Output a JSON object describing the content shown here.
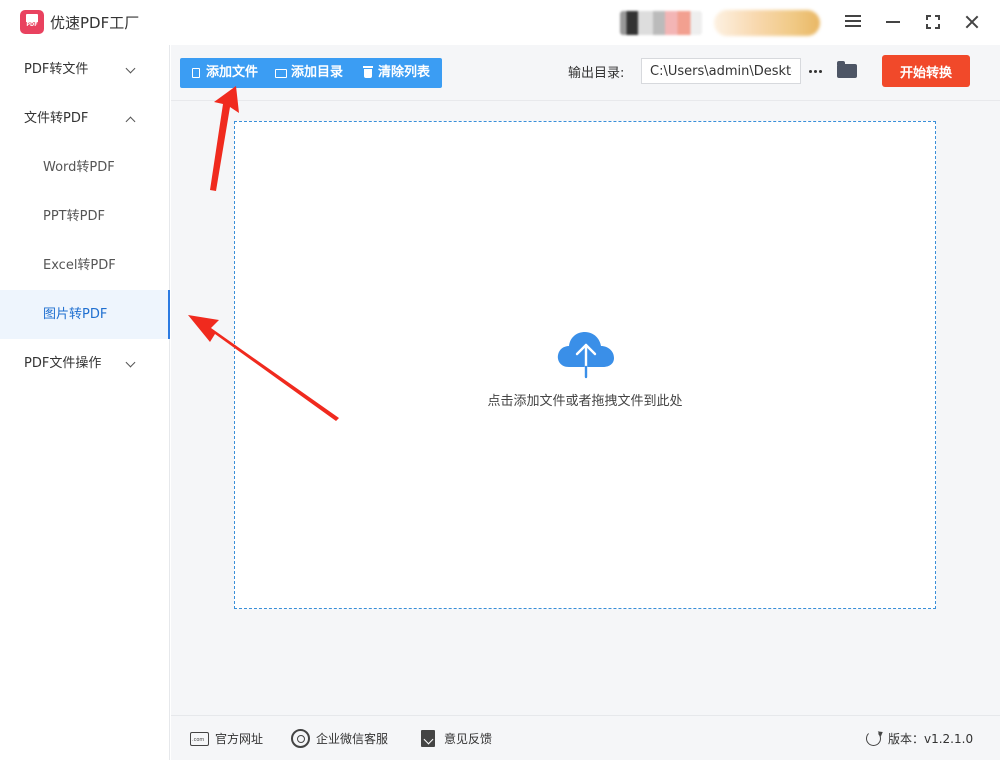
{
  "app": {
    "title": "优速PDF工厂",
    "logo_icon": "pdf-logo-icon"
  },
  "window_controls": [
    "menu-icon",
    "minimize-icon",
    "maximize-icon",
    "close-icon"
  ],
  "sidebar": {
    "groups": [
      {
        "label": "PDF转文件",
        "expanded": false
      },
      {
        "label": "文件转PDF",
        "expanded": true,
        "items": [
          {
            "label": "Word转PDF",
            "active": false
          },
          {
            "label": "PPT转PDF",
            "active": false
          },
          {
            "label": "Excel转PDF",
            "active": false
          },
          {
            "label": "图片转PDF",
            "active": true
          }
        ]
      },
      {
        "label": "PDF文件操作",
        "expanded": false
      }
    ]
  },
  "toolbar": {
    "add_file": "添加文件",
    "add_dir": "添加目录",
    "clear_list": "清除列表",
    "output_label": "输出目录:",
    "output_path": "C:\\Users\\admin\\Desktop",
    "more": "···",
    "start": "开始转换"
  },
  "dropzone": {
    "hint": "点击添加文件或者拖拽文件到此处",
    "icon": "cloud-upload-icon"
  },
  "footer": {
    "website": "官方网址",
    "wechat": "企业微信客服",
    "feedback": "意见反馈",
    "version": "版本：v1.2.1.0"
  },
  "colors": {
    "primary": "#3b9df3",
    "start_button": "#f1492a",
    "active_nav_bg": "#eef5fd",
    "active_nav_text": "#1f6fd0",
    "annotation_arrow": "#f02a1e"
  }
}
